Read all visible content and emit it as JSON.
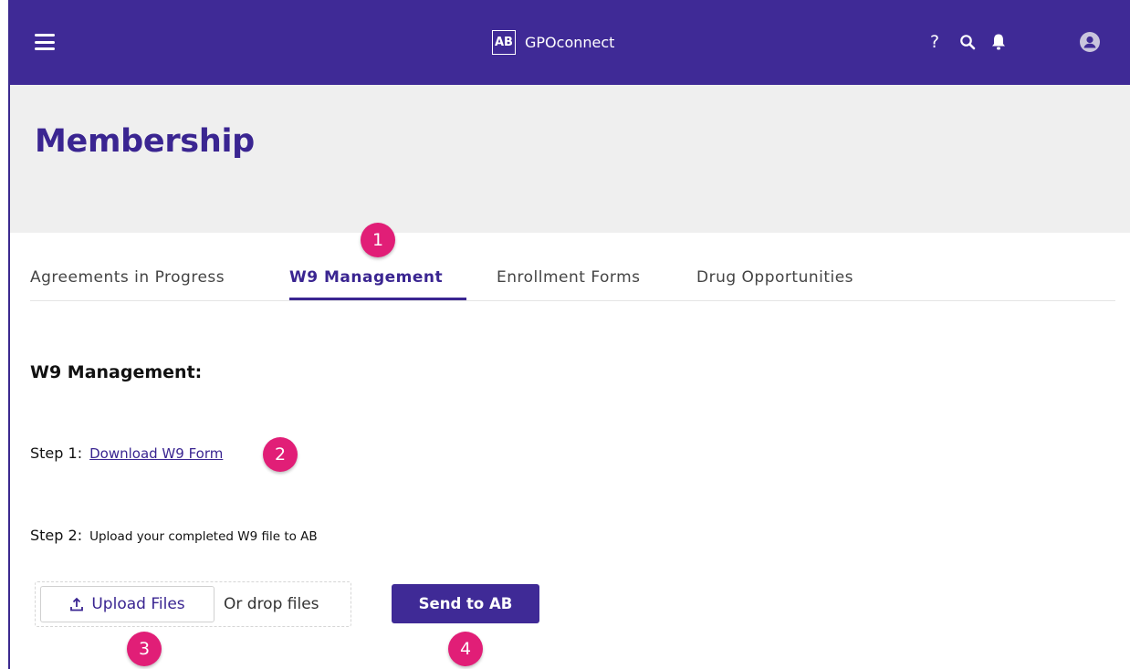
{
  "app": {
    "brand_mark": "AB",
    "brand_name": "GPOconnect"
  },
  "header_icons": {
    "menu": "hamburger-menu-icon",
    "help": "?",
    "search": "search-icon",
    "notifications": "bell-icon",
    "account": "user-avatar-icon"
  },
  "page": {
    "title": "Membership"
  },
  "tabs": [
    {
      "label": "Agreements in Progress",
      "active": false
    },
    {
      "label": "W9 Management",
      "active": true
    },
    {
      "label": "Enrollment Forms",
      "active": false
    },
    {
      "label": "Drug Opportunities",
      "active": false
    }
  ],
  "w9": {
    "section_title": "W9 Management:",
    "step1_label": "Step 1:",
    "step1_link": "Download W9 Form",
    "step2_label": "Step 2:",
    "step2_text": "Upload your completed W9 file to AB",
    "upload_button": "Upload Files",
    "drop_text": "Or drop files",
    "send_button": "Send to AB"
  },
  "callouts": [
    "1",
    "2",
    "3",
    "4"
  ],
  "colors": {
    "primary": "#3f2a96",
    "accent_text": "#3a2591",
    "callout": "#e11e77",
    "hero_bg": "#efefef"
  }
}
